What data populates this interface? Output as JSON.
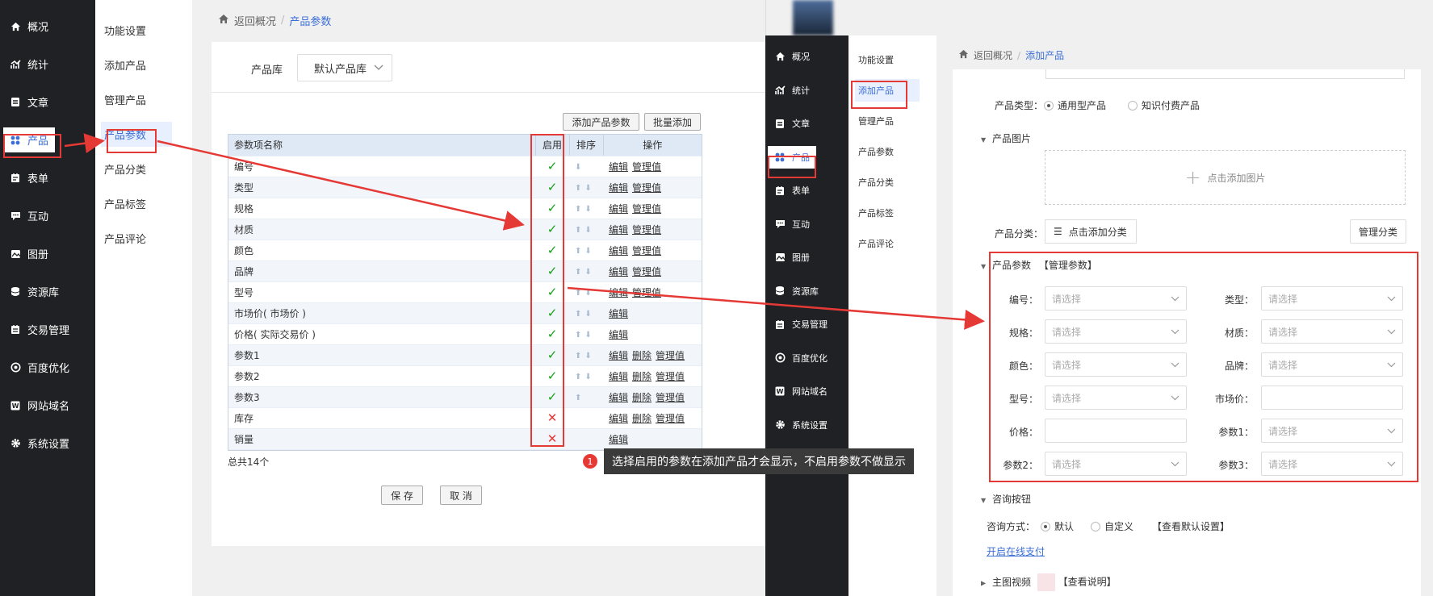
{
  "left": {
    "nav": [
      {
        "label": "概况",
        "icon": "home-icon"
      },
      {
        "label": "统计",
        "icon": "chart-icon"
      },
      {
        "label": "文章",
        "icon": "article-icon"
      },
      {
        "label": "产品",
        "icon": "product-icon"
      },
      {
        "label": "表单",
        "icon": "form-icon"
      },
      {
        "label": "互动",
        "icon": "chat-icon"
      },
      {
        "label": "图册",
        "icon": "gallery-icon"
      },
      {
        "label": "资源库",
        "icon": "database-icon"
      },
      {
        "label": "交易管理",
        "icon": "trade-icon"
      },
      {
        "label": "百度优化",
        "icon": "seo-icon"
      },
      {
        "label": "网站域名",
        "icon": "domain-icon"
      },
      {
        "label": "系统设置",
        "icon": "gear-icon"
      }
    ],
    "subnav": [
      "功能设置",
      "添加产品",
      "管理产品",
      "产品参数",
      "产品分类",
      "产品标签",
      "产品评论"
    ],
    "breadcrumb": {
      "back": "返回概况",
      "sep": "/",
      "current": "产品参数"
    },
    "library": {
      "label": "产品库",
      "value": "默认产品库"
    },
    "buttons": {
      "add_param": "添加产品参数",
      "batch_add": "批量添加",
      "save": "保 存",
      "cancel": "取 消"
    },
    "table": {
      "headers": [
        "参数项名称",
        "启用",
        "排序",
        "操作"
      ],
      "rows": [
        {
          "name": "编号",
          "enabled": "✓"
        },
        {
          "name": "类型",
          "enabled": "✓"
        },
        {
          "name": "规格",
          "enabled": "✓"
        },
        {
          "name": "材质",
          "enabled": "✓"
        },
        {
          "name": "颜色",
          "enabled": "✓"
        },
        {
          "name": "品牌",
          "enabled": "✓"
        },
        {
          "name": "型号",
          "enabled": "✓"
        },
        {
          "name": "市场价( 市场价 )",
          "enabled": "✓"
        },
        {
          "name": "价格( 实际交易价 )",
          "enabled": "✓"
        },
        {
          "name": "参数1",
          "enabled": "✓"
        },
        {
          "name": "参数2",
          "enabled": "✓"
        },
        {
          "name": "参数3",
          "enabled": "✓"
        },
        {
          "name": "库存",
          "enabled": "✕"
        },
        {
          "name": "销量",
          "enabled": "✕"
        }
      ],
      "actions": {
        "edit": "编辑",
        "delete": "删除",
        "manage": "管理值"
      },
      "total": "总共14个"
    }
  },
  "annotation": {
    "badge": "1",
    "text": "选择启用的参数在添加产品才会显示，不启用参数不做显示"
  },
  "right": {
    "nav": [
      {
        "label": "概况",
        "icon": "home-icon"
      },
      {
        "label": "统计",
        "icon": "chart-icon"
      },
      {
        "label": "文章",
        "icon": "article-icon"
      },
      {
        "label": "产品",
        "icon": "product-icon"
      },
      {
        "label": "表单",
        "icon": "form-icon"
      },
      {
        "label": "互动",
        "icon": "chat-icon"
      },
      {
        "label": "图册",
        "icon": "gallery-icon"
      },
      {
        "label": "资源库",
        "icon": "database-icon"
      },
      {
        "label": "交易管理",
        "icon": "trade-icon"
      },
      {
        "label": "百度优化",
        "icon": "seo-icon"
      },
      {
        "label": "网站域名",
        "icon": "domain-icon"
      },
      {
        "label": "系统设置",
        "icon": "gear-icon"
      }
    ],
    "subnav": [
      "功能设置",
      "添加产品",
      "管理产品",
      "产品参数",
      "产品分类",
      "产品标签",
      "产品评论"
    ],
    "breadcrumb": {
      "back": "返回概况",
      "sep": "/",
      "current": "添加产品"
    },
    "product_type": {
      "label": "产品类型：",
      "opt1": "通用型产品",
      "opt2": "知识付费产品"
    },
    "image": {
      "section": "产品图片",
      "add": "点击添加图片"
    },
    "category": {
      "label": "产品分类：",
      "add": "点击添加分类",
      "manage": "管理分类"
    },
    "params": {
      "section": "产品参数",
      "manage": "【管理参数】",
      "fields": [
        {
          "label": "编号：",
          "placeholder": "请选择",
          "kind": "select"
        },
        {
          "label": "类型：",
          "placeholder": "请选择",
          "kind": "select"
        },
        {
          "label": "规格：",
          "placeholder": "请选择",
          "kind": "select"
        },
        {
          "label": "材质：",
          "placeholder": "请选择",
          "kind": "select"
        },
        {
          "label": "颜色：",
          "placeholder": "请选择",
          "kind": "select"
        },
        {
          "label": "品牌：",
          "placeholder": "请选择",
          "kind": "select"
        },
        {
          "label": "型号：",
          "placeholder": "请选择",
          "kind": "select"
        },
        {
          "label": "市场价：",
          "placeholder": "",
          "kind": "input"
        },
        {
          "label": "价格：",
          "placeholder": "",
          "kind": "input"
        },
        {
          "label": "参数1：",
          "placeholder": "请选择",
          "kind": "select"
        },
        {
          "label": "参数2：",
          "placeholder": "请选择",
          "kind": "select"
        },
        {
          "label": "参数3：",
          "placeholder": "请选择",
          "kind": "select"
        }
      ]
    },
    "consult": {
      "section": "咨询按钮",
      "label": "咨询方式：",
      "opt1": "默认",
      "opt2": "自定义",
      "link": "【查看默认设置】"
    },
    "online_pay": "开启在线支付",
    "video": {
      "section": "主图视频",
      "link": "【查看说明】"
    }
  },
  "colors": {
    "accent": "#3b6ed6",
    "red": "#e53935",
    "green": "#14a014",
    "nav_bg": "#202124"
  }
}
